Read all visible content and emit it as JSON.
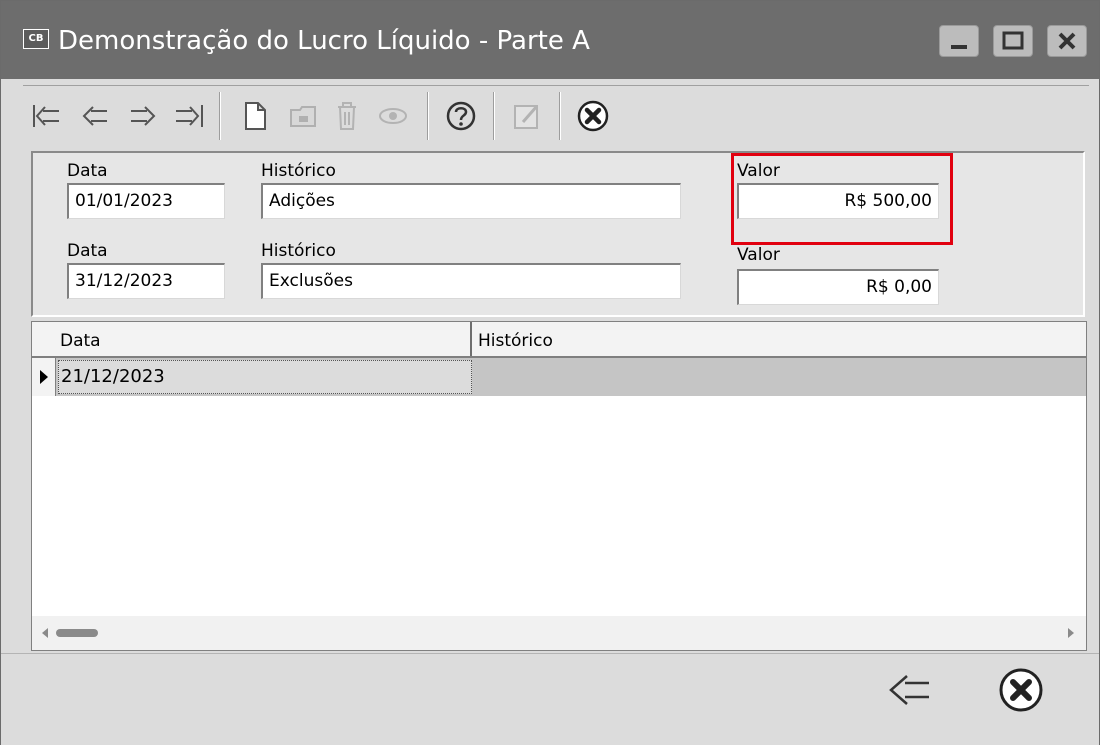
{
  "window": {
    "icon_label": "CB",
    "title": "Demonstração do Lucro Líquido - Parte A"
  },
  "toolbar": {
    "buttons": [
      {
        "name": "first-record",
        "icon": "first-arrow-icon",
        "enabled": true
      },
      {
        "name": "previous-record",
        "icon": "left-arrow-icon",
        "enabled": true
      },
      {
        "name": "next-record",
        "icon": "right-arrow-icon",
        "enabled": true
      },
      {
        "name": "last-record",
        "icon": "last-arrow-icon",
        "enabled": true
      },
      {
        "name": "new",
        "icon": "new-document-icon",
        "enabled": true
      },
      {
        "name": "open",
        "icon": "folder-icon",
        "enabled": false
      },
      {
        "name": "delete",
        "icon": "trash-icon",
        "enabled": false
      },
      {
        "name": "view",
        "icon": "eye-icon",
        "enabled": false
      },
      {
        "name": "help",
        "icon": "help-icon",
        "enabled": true
      },
      {
        "name": "edit",
        "icon": "edit-icon",
        "enabled": false
      },
      {
        "name": "close",
        "icon": "close-circle-icon",
        "enabled": true
      }
    ]
  },
  "form": {
    "row1": {
      "date_label": "Data",
      "date_value": "01/01/2023",
      "history_label": "Histórico",
      "history_value": "Adições",
      "value_label": "Valor",
      "value_value": "R$ 500,00"
    },
    "row2": {
      "date_label": "Data",
      "date_value": "31/12/2023",
      "history_label": "Histórico",
      "history_value": "Exclusões",
      "value_label": "Valor",
      "value_value": "R$ 0,00"
    }
  },
  "grid": {
    "columns": [
      "Data",
      "Histórico"
    ],
    "rows": [
      {
        "data": "21/12/2023",
        "historico": ""
      }
    ]
  },
  "colors": {
    "highlight": "#e1000f",
    "titlebar": "#6d6d6d",
    "selected_row": "#c5c5c5"
  }
}
